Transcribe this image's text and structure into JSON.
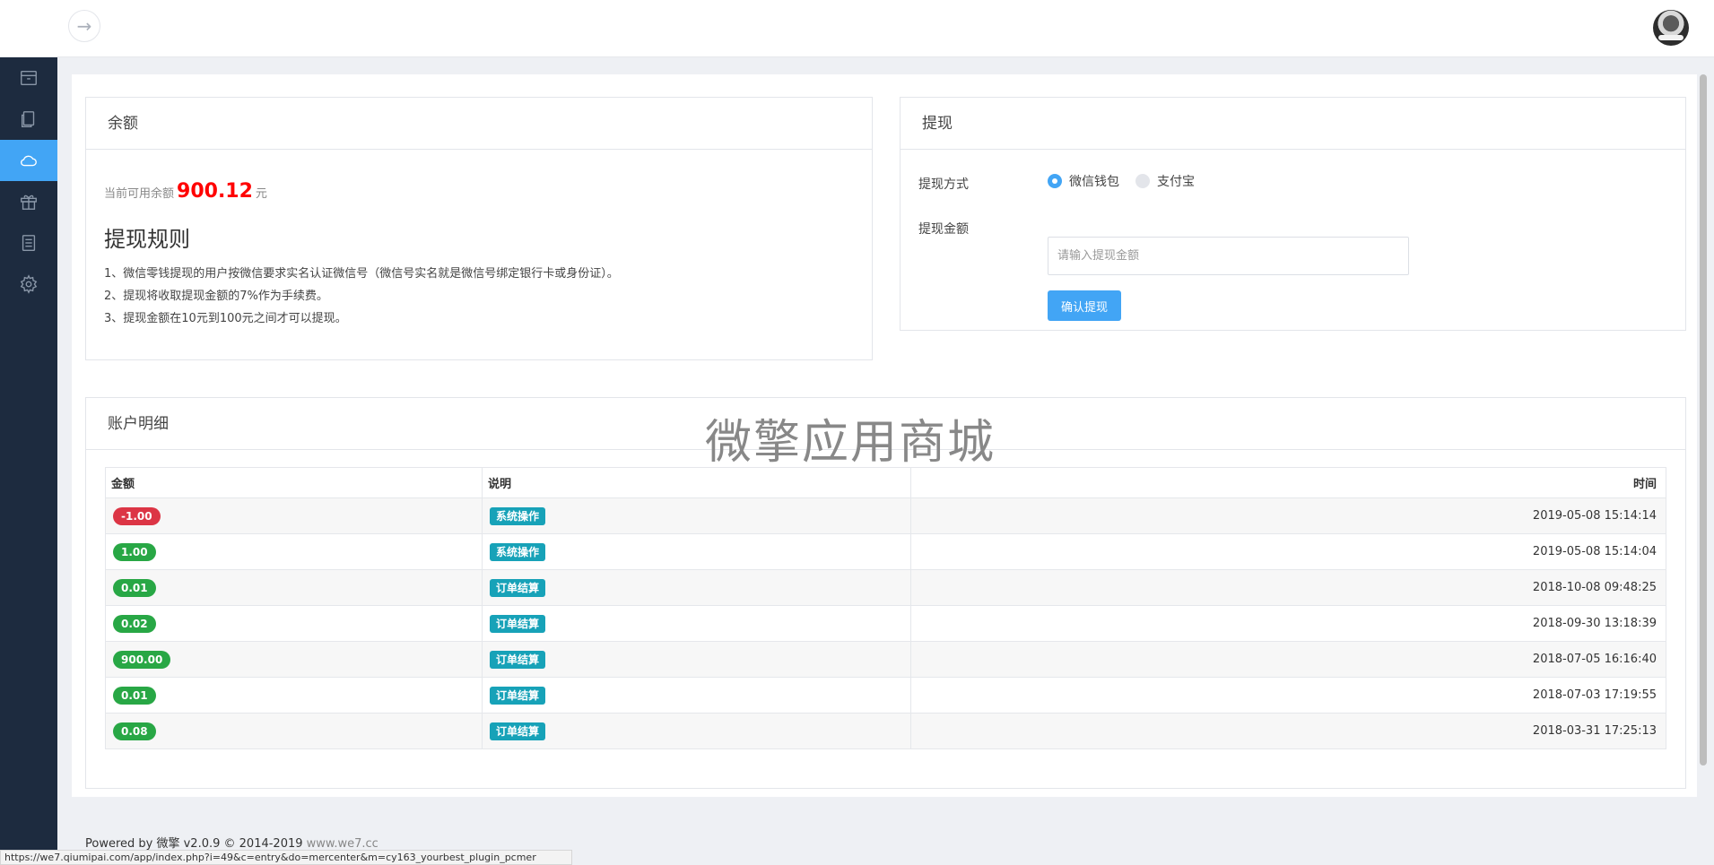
{
  "header": {
    "toggle_glyph": "→",
    "toggle_icon": "arrow-right-icon",
    "avatar_icon": "user-avatar"
  },
  "sidebar": {
    "items": [
      {
        "icon": "box-icon",
        "active": false
      },
      {
        "icon": "document-icon",
        "active": false
      },
      {
        "icon": "cloud-icon",
        "active": true
      },
      {
        "icon": "gift-icon",
        "active": false
      },
      {
        "icon": "list-icon",
        "active": false
      },
      {
        "icon": "gear-icon",
        "active": false
      }
    ],
    "active_color": "#42a5f5",
    "bg_color": "#1d2b3f"
  },
  "balance": {
    "title": "余额",
    "available_label": "当前可用余额",
    "amount": "900.12",
    "unit": "元",
    "rules_title": "提现规则",
    "rules": [
      "1、微信零钱提现的用户按微信要求实名认证微信号（微信号实名就是微信号绑定银行卡或身份证）。",
      "2、提现将收取提现金额的7%作为手续费。",
      "3、提现金额在10元到100元之间才可以提现。"
    ]
  },
  "withdraw": {
    "title": "提现",
    "method_label": "提现方式",
    "methods": [
      {
        "label": "微信钱包",
        "selected": true
      },
      {
        "label": "支付宝",
        "selected": false
      }
    ],
    "amount_label": "提现金额",
    "amount_placeholder": "请输入提现金额",
    "amount_value": "",
    "confirm_label": "确认提现"
  },
  "detail": {
    "title": "账户明细",
    "watermark": "微擎应用商城",
    "columns": [
      "金额",
      "说明",
      "时间"
    ],
    "rows": [
      {
        "amount": "-1.00",
        "tone": "red",
        "note": "系统操作",
        "time": "2019-05-08 15:14:14"
      },
      {
        "amount": "1.00",
        "tone": "green",
        "note": "系统操作",
        "time": "2019-05-08 15:14:04"
      },
      {
        "amount": "0.01",
        "tone": "green",
        "note": "订单结算",
        "time": "2018-10-08 09:48:25"
      },
      {
        "amount": "0.02",
        "tone": "green",
        "note": "订单结算",
        "time": "2018-09-30 13:18:39"
      },
      {
        "amount": "900.00",
        "tone": "green",
        "note": "订单结算",
        "time": "2018-07-05 16:16:40"
      },
      {
        "amount": "0.01",
        "tone": "green",
        "note": "订单结算",
        "time": "2018-07-03 17:19:55"
      },
      {
        "amount": "0.08",
        "tone": "green",
        "note": "订单结算",
        "time": "2018-03-31 17:25:13"
      }
    ]
  },
  "footer": {
    "powered": "Powered by 微擎 v2.0.9 © 2014-2019 ",
    "link": "www.we7.cc"
  },
  "statusbar": {
    "url": "https://we7.qiumipai.com/app/index.php?i=49&c=entry&do=mercenter&m=cy163_yourbest_plugin_pcmer"
  }
}
